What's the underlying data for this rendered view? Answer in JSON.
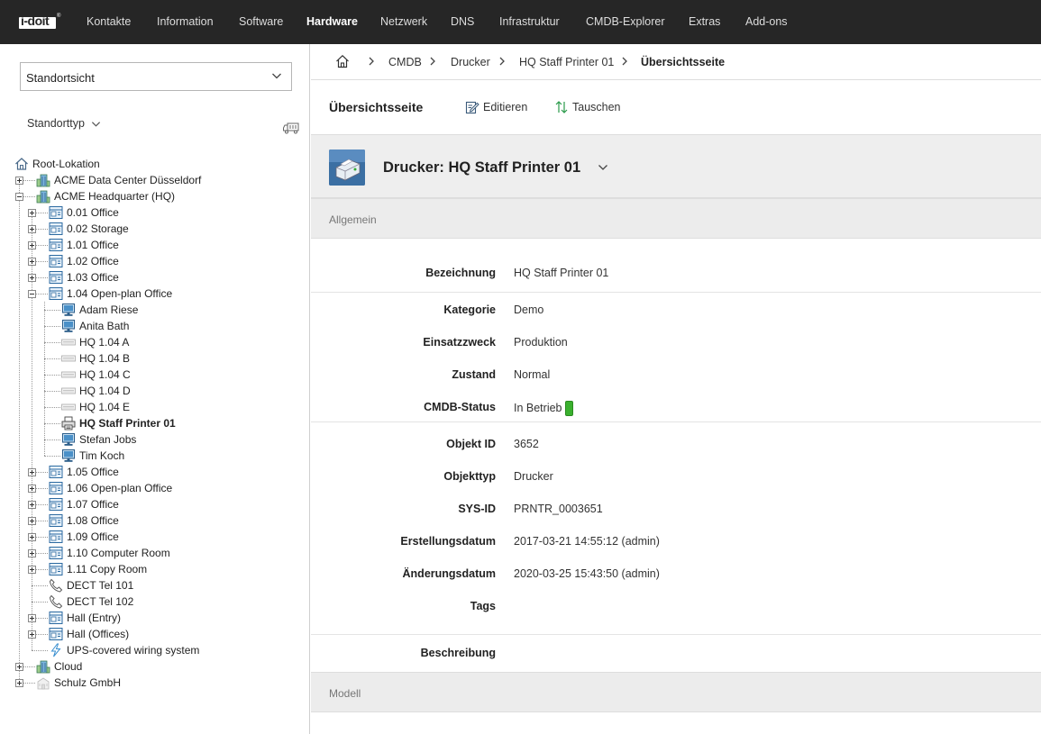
{
  "app": {
    "logo_text": "i-doit",
    "logo_tm": "®"
  },
  "nav": {
    "items": [
      {
        "label": "Kontakte"
      },
      {
        "label": "Information"
      },
      {
        "label": "Software"
      },
      {
        "label": "Hardware"
      },
      {
        "label": "Netzwerk"
      },
      {
        "label": "DNS"
      },
      {
        "label": "Infrastruktur"
      },
      {
        "label": "CMDB-Explorer"
      },
      {
        "label": "Extras"
      },
      {
        "label": "Add-ons"
      }
    ],
    "active": "Hardware"
  },
  "sidebar": {
    "view_select": {
      "value": "Standortsicht"
    },
    "location_type_label": "Standorttyp",
    "tree": [
      {
        "label": "Root-Lokation",
        "icon": "home-icon"
      },
      {
        "label": "ACME Data Center Düsseldorf",
        "icon": "building-icon"
      },
      {
        "label": "ACME Headquarter (HQ)",
        "icon": "building-icon"
      },
      {
        "label": "0.01 Office",
        "icon": "room-icon"
      },
      {
        "label": "0.02 Storage",
        "icon": "room-icon"
      },
      {
        "label": "1.01 Office",
        "icon": "room-icon"
      },
      {
        "label": "1.02 Office",
        "icon": "room-icon"
      },
      {
        "label": "1.03 Office",
        "icon": "room-icon"
      },
      {
        "label": "1.04 Open-plan Office",
        "icon": "room-icon"
      },
      {
        "label": "Adam Riese",
        "icon": "monitor-icon"
      },
      {
        "label": "Anita Bath",
        "icon": "monitor-icon"
      },
      {
        "label": "HQ 1.04 A",
        "icon": "patch-panel-icon"
      },
      {
        "label": "HQ 1.04 B",
        "icon": "patch-panel-icon"
      },
      {
        "label": "HQ 1.04 C",
        "icon": "patch-panel-icon"
      },
      {
        "label": "HQ 1.04 D",
        "icon": "patch-panel-icon"
      },
      {
        "label": "HQ 1.04 E",
        "icon": "patch-panel-icon"
      },
      {
        "label": "HQ Staff Printer 01",
        "icon": "printer-icon"
      },
      {
        "label": "Stefan Jobs",
        "icon": "monitor-icon"
      },
      {
        "label": "Tim Koch",
        "icon": "monitor-icon"
      },
      {
        "label": "1.05 Office",
        "icon": "room-icon"
      },
      {
        "label": "1.06 Open-plan Office",
        "icon": "room-icon"
      },
      {
        "label": "1.07 Office",
        "icon": "room-icon"
      },
      {
        "label": "1.08 Office",
        "icon": "room-icon"
      },
      {
        "label": "1.09 Office",
        "icon": "room-icon"
      },
      {
        "label": "1.10 Computer Room",
        "icon": "room-icon"
      },
      {
        "label": "1.11 Copy Room",
        "icon": "room-icon"
      },
      {
        "label": "DECT Tel 101",
        "icon": "phone-icon"
      },
      {
        "label": "DECT Tel 102",
        "icon": "phone-icon"
      },
      {
        "label": "Hall (Entry)",
        "icon": "room-icon"
      },
      {
        "label": "Hall (Offices)",
        "icon": "room-icon"
      },
      {
        "label": "UPS-covered wiring system",
        "icon": "lightning-icon"
      },
      {
        "label": "Cloud",
        "icon": "building-icon"
      },
      {
        "label": "Schulz GmbH",
        "icon": "building-gray-icon"
      }
    ]
  },
  "breadcrumb": [
    {
      "label": "CMDB"
    },
    {
      "label": "Drucker"
    },
    {
      "label": "HQ Staff Printer 01"
    },
    {
      "label": "Übersichtsseite"
    }
  ],
  "toolbar": {
    "title": "Übersichtsseite",
    "edit_label": "Editieren",
    "swap_label": "Tauschen"
  },
  "object": {
    "title": "Drucker: HQ Staff Printer 01",
    "icon": "printer-icon"
  },
  "sections": {
    "general": "Allgemein",
    "model": "Modell"
  },
  "fields": [
    {
      "label": "Bezeichnung",
      "value": "HQ Staff Printer 01"
    },
    {
      "label": "Kategorie",
      "value": "Demo"
    },
    {
      "label": "Einsatzzweck",
      "value": "Produktion"
    },
    {
      "label": "Zustand",
      "value": "Normal"
    },
    {
      "label": "CMDB-Status",
      "value": "In Betrieb",
      "badge_color": "#3ab02e"
    },
    {
      "label": "Objekt ID",
      "value": "3652"
    },
    {
      "label": "Objekttyp",
      "value": "Drucker"
    },
    {
      "label": "SYS-ID",
      "value": "PRNTR_0003651"
    },
    {
      "label": "Erstellungsdatum",
      "value": "2017-03-21 14:55:12 (admin)"
    },
    {
      "label": "Änderungsdatum",
      "value": "2020-03-25 15:43:50 (admin)"
    },
    {
      "label": "Tags",
      "value": ""
    },
    {
      "label": "Beschreibung",
      "value": ""
    }
  ],
  "colors": {
    "topbar": "#262626",
    "accent_green": "#3ab02e",
    "section_bg": "#ececec"
  }
}
